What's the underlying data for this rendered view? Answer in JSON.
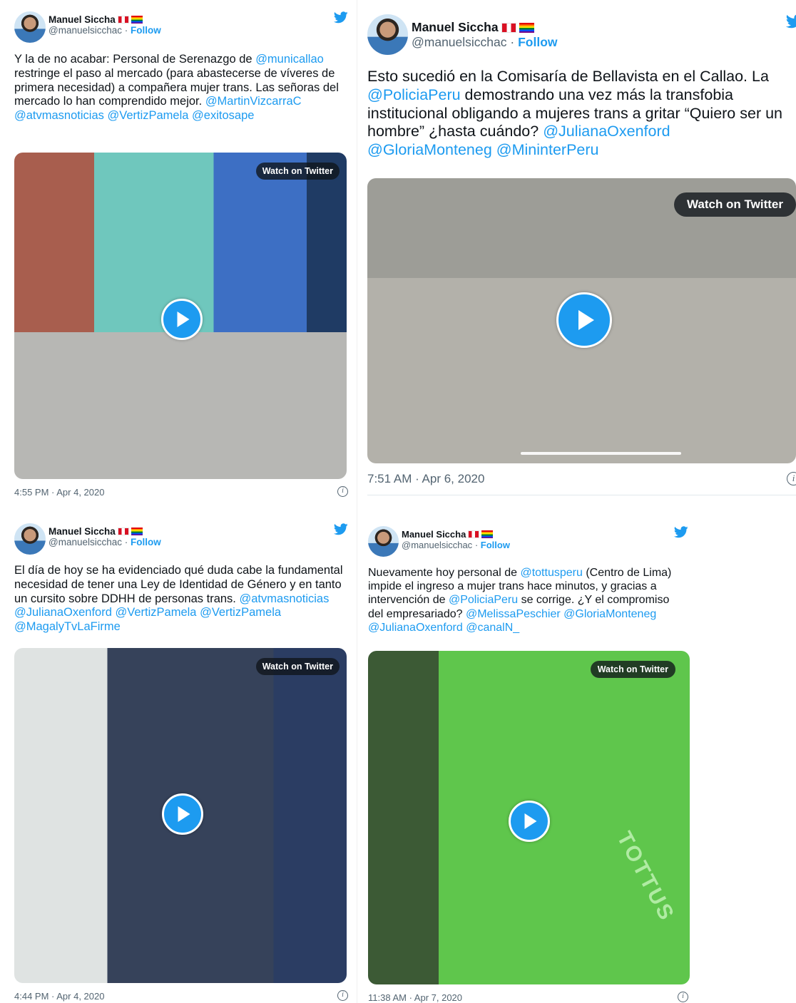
{
  "tweets": [
    {
      "author_name": "Manuel Siccha",
      "handle": "@manuelsicchac",
      "separator": "·",
      "follow_label": "Follow",
      "text_parts": [
        {
          "t": "Y la de no acabar: Personal de Serenazgo de ",
          "mention": false
        },
        {
          "t": "@municallao",
          "mention": true
        },
        {
          "t": " restringe el paso al mercado (para abastecerse de víveres de primera necesidad) a compañera mujer trans.  Las señoras del mercado lo han comprendido mejor. ",
          "mention": false
        },
        {
          "t": "@MartinVizcarraC",
          "mention": true
        },
        {
          "t": " ",
          "mention": false
        },
        {
          "t": "@atvmasnoticias",
          "mention": true
        },
        {
          "t": " ",
          "mention": false
        },
        {
          "t": "@VertizPamela",
          "mention": true
        },
        {
          "t": " ",
          "mention": false
        },
        {
          "t": "@exitosape",
          "mention": true
        }
      ],
      "watch_label": "Watch on Twitter",
      "timestamp": "4:55 PM · Apr 4, 2020",
      "info_glyph": "i"
    },
    {
      "author_name": "Manuel Siccha",
      "handle": "@manuelsicchac",
      "separator": "·",
      "follow_label": "Follow",
      "text_parts": [
        {
          "t": "Esto sucedió en la Comisaría de Bellavista en el Callao. La ",
          "mention": false
        },
        {
          "t": "@PoliciaPeru",
          "mention": true
        },
        {
          "t": "  demostrando una vez más la transfobia institucional obligando a mujeres trans a gritar “Quiero ser un hombre” ¿hasta cuándo? ",
          "mention": false
        },
        {
          "t": "@JulianaOxenford",
          "mention": true
        },
        {
          "t": " ",
          "mention": false
        },
        {
          "t": "@GloriaMonteneg",
          "mention": true
        },
        {
          "t": " ",
          "mention": false
        },
        {
          "t": "@MininterPeru",
          "mention": true
        }
      ],
      "watch_label": "Watch on Twitter",
      "timestamp": "7:51 AM · Apr 6, 2020",
      "info_glyph": "i"
    },
    {
      "author_name": "Manuel Siccha",
      "handle": "@manuelsicchac",
      "separator": "·",
      "follow_label": "Follow",
      "text_parts": [
        {
          "t": "El día de hoy se ha evidenciado qué duda cabe la fundamental necesidad de tener una Ley de Identidad de Género y en tanto un cursito sobre DDHH de personas trans. ",
          "mention": false
        },
        {
          "t": "@atvmasnoticias",
          "mention": true
        },
        {
          "t": " ",
          "mention": false
        },
        {
          "t": "@JulianaOxenford",
          "mention": true
        },
        {
          "t": " ",
          "mention": false
        },
        {
          "t": "@VertizPamela",
          "mention": true
        },
        {
          "t": " ",
          "mention": false
        },
        {
          "t": "@VertizPamela",
          "mention": true
        },
        {
          "t": " ",
          "mention": false
        },
        {
          "t": "@MagalyTvLaFirme",
          "mention": true
        }
      ],
      "watch_label": "Watch on Twitter",
      "timestamp": "4:44 PM · Apr 4, 2020",
      "info_glyph": "i"
    },
    {
      "author_name": "Manuel Siccha",
      "handle": "@manuelsicchac",
      "separator": "·",
      "follow_label": "Follow",
      "text_parts": [
        {
          "t": "Nuevamente hoy personal de ",
          "mention": false
        },
        {
          "t": "@tottusperu",
          "mention": true
        },
        {
          "t": " (Centro de Lima) impide el ingreso a mujer trans hace minutos, y gracias a intervención de ",
          "mention": false
        },
        {
          "t": "@PoliciaPeru",
          "mention": true
        },
        {
          "t": " se corrige. ¿Y el compromiso del empresariado? ",
          "mention": false
        },
        {
          "t": "@MelissaPeschier",
          "mention": true
        },
        {
          "t": " ",
          "mention": false
        },
        {
          "t": "@GloriaMonteneg",
          "mention": true
        },
        {
          "t": " ",
          "mention": false
        },
        {
          "t": "@JulianaOxenford",
          "mention": true
        },
        {
          "t": " ",
          "mention": false
        },
        {
          "t": "@canalN_",
          "mention": true
        }
      ],
      "watch_label": "Watch on Twitter",
      "video_overlay_text": "TOTTUS",
      "timestamp": "11:38 AM · Apr 7, 2020",
      "info_glyph": "i"
    }
  ],
  "icons": {
    "bird": "twitter-bird-icon",
    "play": "play-icon",
    "info": "info-icon",
    "flag_pe": "peru-flag-icon",
    "flag_pride": "rainbow-flag-icon"
  },
  "colors": {
    "link": "#1d9bf0",
    "secondary_text": "#536471",
    "primary_text": "#0f1419"
  }
}
